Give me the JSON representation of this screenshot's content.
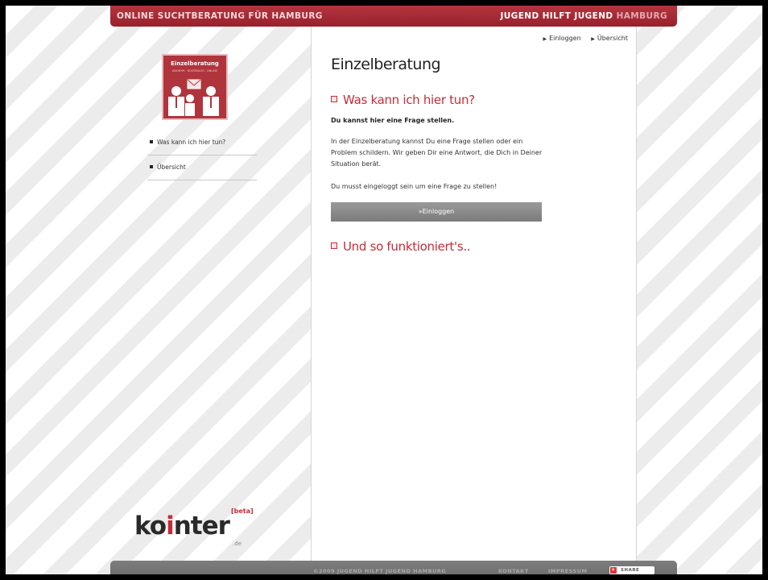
{
  "header": {
    "left_title": "ONLINE SUCHTBERATUNG FÜR HAMBURG",
    "right_brand_bold": "JUGEND HILFT JUGEND",
    "right_brand_light": "HAMBURG"
  },
  "sidebar": {
    "logo_title": "Einzelberatung",
    "logo_subtitle": "ANONYM · KOSTENLOS · ONLINE",
    "items": [
      {
        "label": "Was kann ich hier tun?"
      },
      {
        "label": "Übersicht"
      }
    ],
    "brand": {
      "word_start": "ko",
      "word_dot": "i",
      "word_end": "nter",
      "beta": "[beta]",
      "tld": ".de"
    }
  },
  "toplinks": {
    "login": "Einloggen",
    "overview": "Übersicht"
  },
  "main": {
    "title": "Einzelberatung",
    "section1_title": "Was kann ich hier tun?",
    "bold_line": "Du kannst hier eine Frage stellen.",
    "paragraph": "In der Einzelberatung kannst Du eine Frage stellen oder ein Problem schildern. Wir geben Dir eine Antwort, die Dich in Deiner Situation berät.",
    "paragraph2": "Du musst eingeloggt sein um eine Frage zu stellen!",
    "login_button": "»Einloggen",
    "section2_title": "Und so funktioniert's.."
  },
  "footer": {
    "copyright": "©2009 JUGEND HILFT JUGEND HAMBURG",
    "kontakt": "KONTAKT",
    "impressum": "IMPRESSUM",
    "share": "SHARE"
  },
  "colors": {
    "brand_red": "#b0343c",
    "accent_red": "#c42d3a",
    "footer_gray": "#737373",
    "button_gray": "#8a8a8a"
  }
}
